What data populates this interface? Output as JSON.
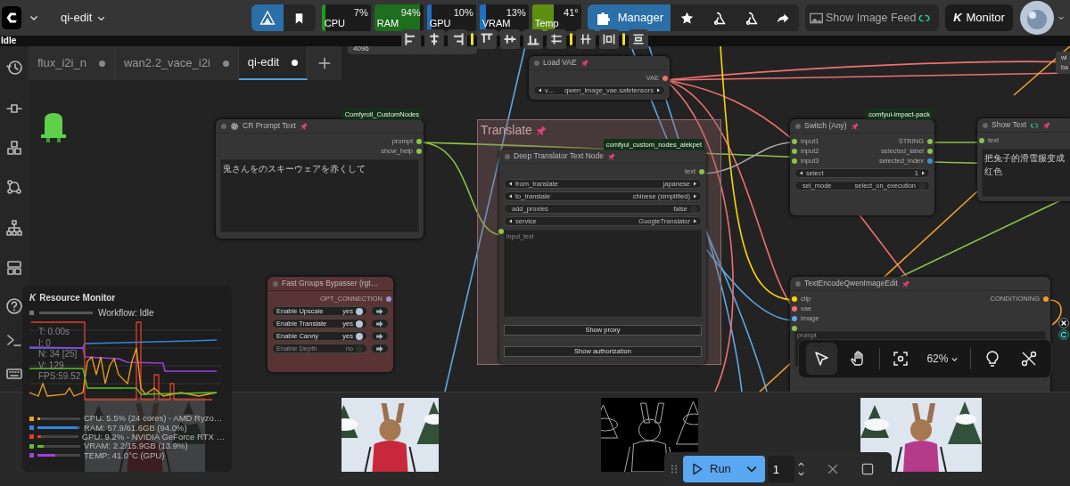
{
  "header": {
    "workflow_menu": "qi-edit",
    "status": "Idle",
    "meters": [
      {
        "label": "CPU",
        "reading": "7%",
        "level": 0.07,
        "color": "#1f9a1f"
      },
      {
        "label": "RAM",
        "reading": "94%",
        "level": 0.94,
        "color": "#1d6e1d"
      },
      {
        "label": "GPU",
        "reading": "10%",
        "level": 0.1,
        "color": "#1f6fc4"
      },
      {
        "label": "VRAM",
        "reading": "13%",
        "level": 0.13,
        "color": "#1f6fc4"
      },
      {
        "label": "Temp",
        "reading": "41°",
        "level": 0.45,
        "color": "#5f8f12"
      }
    ],
    "manager": "Manager",
    "image_feed": "Show Image Feed",
    "monitor_logo": "K",
    "monitor": "Monitor"
  },
  "tabs": [
    {
      "label": "flux_i2i_n",
      "selected": false
    },
    {
      "label": "wan2.2_vace_i2i",
      "selected": false
    },
    {
      "label": "qi-edit",
      "selected": true
    }
  ],
  "canvas": {
    "fragments": [
      {
        "lines": [
          "4096"
        ]
      },
      {
        "lines": [
          "wi",
          "ba"
        ]
      }
    ],
    "group": {
      "title": "Translate",
      "pinned": true
    },
    "nodes": [
      {
        "title": "CR Prompt Text",
        "badge": "Comfyroll_CustomNodes",
        "pinned": true,
        "rows": [
          {
            "output": {
              "label": "prompt",
              "color": "#8bc34a"
            }
          },
          {
            "output": {
              "label": "show_help",
              "color": "#8bc34a"
            }
          }
        ],
        "widgets": [
          {
            "kind": "text",
            "value": "兎さんをのスキーウェアを赤くして"
          }
        ]
      },
      {
        "title": "Fast Groups Bypasser (rgt…",
        "pinned": false,
        "color": "#5a3434",
        "rows": [
          {
            "output": {
              "label": "OPT_CONNECTION",
              "color": "#9a8fd0"
            }
          }
        ],
        "widgets": [
          {
            "kind": "group_toggle",
            "label": "Enable Upscale",
            "value": "yes",
            "on": true
          },
          {
            "kind": "group_toggle",
            "label": "Enable Translate",
            "value": "yes",
            "on": true
          },
          {
            "kind": "group_toggle",
            "label": "Enable Canny",
            "value": "yes",
            "on": true
          },
          {
            "kind": "group_toggle",
            "label": "Enable Depth",
            "value": "no",
            "on": false
          }
        ]
      },
      {
        "title": "Load VAE",
        "pinned": true,
        "rows": [
          {
            "output": {
              "label": "VAE",
              "color": "#f07070"
            }
          }
        ],
        "widgets": [
          {
            "kind": "combo",
            "label": "v…",
            "value": "qwen_image_vae.safetensors"
          }
        ]
      },
      {
        "title": "Deep Translator Text Node",
        "badge": "comfyui_custom_nodes_alekpet",
        "pinned": true,
        "rows": [
          {
            "output": {
              "label": "text",
              "color": "#8bc34a"
            }
          }
        ],
        "widgets": [
          {
            "kind": "combo",
            "label": "from_translate",
            "value": "japanese"
          },
          {
            "kind": "combo",
            "label": "to_translate",
            "value": "chinese (simplified)"
          },
          {
            "kind": "toggle",
            "label": "add_proxies",
            "value": "false",
            "on": false
          },
          {
            "kind": "combo",
            "label": "service",
            "value": "GoogleTranslator"
          },
          {
            "kind": "text",
            "placeholder": "input_text",
            "linked": true
          },
          {
            "kind": "button",
            "label": "Show proxy"
          },
          {
            "kind": "button",
            "label": "Show authorization"
          }
        ]
      },
      {
        "title": "Switch (Any)",
        "badge": "comfyui-impact-pack",
        "pinned": true,
        "rows": [
          {
            "input": {
              "label": "input1",
              "color": "#8bc34a"
            },
            "output": {
              "label": "STRING",
              "color": "#8bc34a"
            }
          },
          {
            "input": {
              "label": "input2",
              "color": "#8bc34a"
            },
            "output": {
              "label": "selected_label",
              "color": "#8bc34a"
            }
          },
          {
            "input": {
              "label": "input3",
              "color": "#8bc34a"
            },
            "output": {
              "label": "selected_index",
              "color": "#3b8fd6"
            }
          }
        ],
        "widgets": [
          {
            "kind": "combo",
            "label": "select",
            "value": "1"
          },
          {
            "kind": "toggle",
            "label": "sel_mode",
            "value": "select_on_execution",
            "on": false
          }
        ]
      },
      {
        "title": "TextEncodeQwenImageEdit",
        "pinned": true,
        "rows": [
          {
            "input": {
              "label": "clip",
              "color": "#ffd500"
            },
            "output": {
              "label": "CONDITIONING",
              "color": "#f0a030"
            }
          },
          {
            "input": {
              "label": "vae",
              "color": "#f07070"
            }
          },
          {
            "input": {
              "label": "image",
              "color": "#5ca9e6"
            }
          },
          {
            "input": {
              "color": "#8bc34a"
            }
          }
        ],
        "widgets": [
          {
            "kind": "text",
            "placeholder": "prompt"
          }
        ]
      },
      {
        "title": "Show Text",
        "pinned": true,
        "rows": [
          {
            "input": {
              "label": "text",
              "color": "#8bc34a"
            }
          }
        ],
        "widgets": [
          {
            "kind": "text",
            "value": "把兔子的滑雪服变成红色"
          }
        ]
      }
    ],
    "zoom": "62%",
    "tools": [
      {
        "kind": "select",
        "selected": true
      },
      {
        "kind": "hand",
        "selected": false
      }
    ]
  },
  "resource_monitor": {
    "logo": "K",
    "title": "Resource Monitor",
    "workflow": "Workflow: Idle",
    "stats": [
      "T: 0.00s",
      "I: 0",
      "N: 34 [25]",
      "V: 129",
      "FPS:59.52"
    ],
    "legend": [
      {
        "text": "CPU: 5.5% (24 cores) - AMD Ryzo…",
        "level": 0.06,
        "color": "#f0a020"
      },
      {
        "text": "RAM: 57.9/61.6GB (94.0%)",
        "level": 0.94,
        "color": "#2f86e0"
      },
      {
        "text": "GPU: 9.2% - NVIDIA GeForce RTX …",
        "level": 0.09,
        "color": "#e0402a"
      },
      {
        "text": "VRAM: 2.2/15.9GB (13.9%)",
        "level": 0.14,
        "color": "#5cc02a"
      },
      {
        "text": "TEMP: 41.0°C (GPU)",
        "level": 0.41,
        "color": "#a040e0"
      }
    ]
  },
  "run_bar": {
    "run": "Run",
    "count": "1"
  }
}
